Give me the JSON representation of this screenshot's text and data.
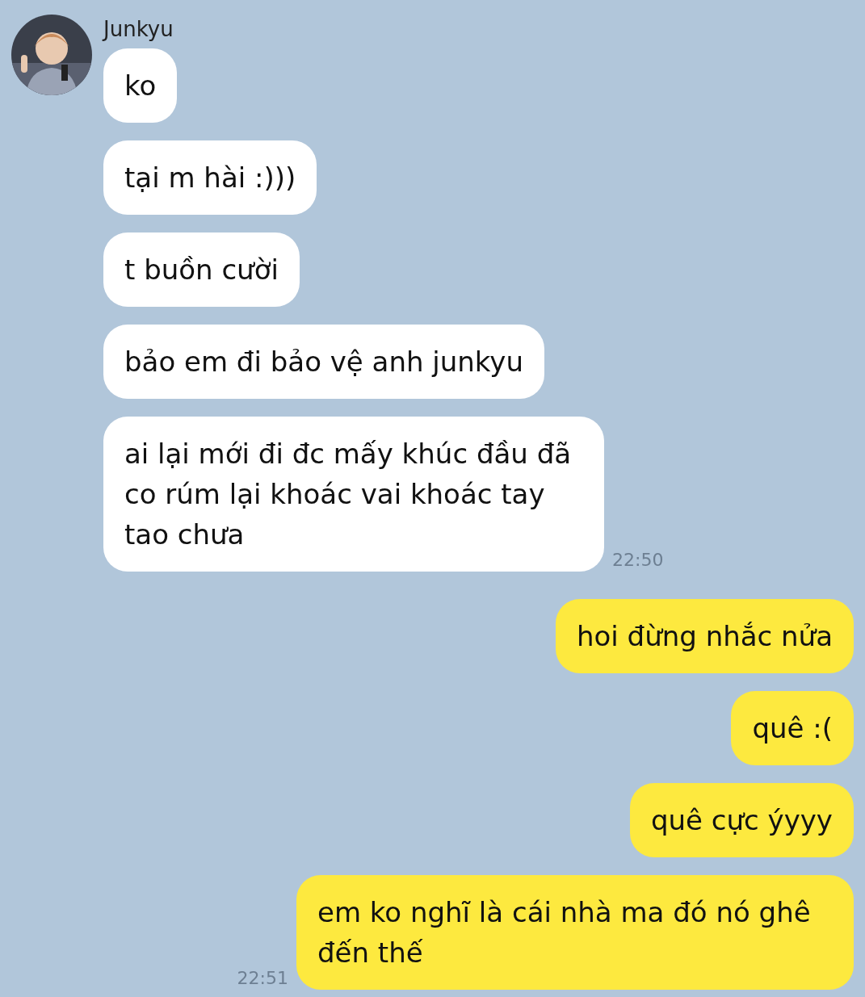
{
  "contact": {
    "name": "Junkyu"
  },
  "messages": [
    {
      "kind": "incoming",
      "text": "ko"
    },
    {
      "kind": "incoming",
      "text": "tại m hài :)))"
    },
    {
      "kind": "incoming",
      "text": "t buồn cười"
    },
    {
      "kind": "incoming",
      "text": "bảo em đi bảo vệ anh junkyu"
    },
    {
      "kind": "incoming",
      "text": "ai lại mới đi đc mấy khúc đầu đã co rúm lại khoác vai khoác tay tao chưa",
      "time": "22:50"
    },
    {
      "kind": "outgoing",
      "text": "hoi đừng nhắc nửa"
    },
    {
      "kind": "outgoing",
      "text": "quê :("
    },
    {
      "kind": "outgoing",
      "text": "quê cực ýyyy"
    },
    {
      "kind": "outgoing",
      "text": "em ko nghĩ là cái nhà ma đó nó ghê đến thế",
      "time": "22:51"
    }
  ]
}
